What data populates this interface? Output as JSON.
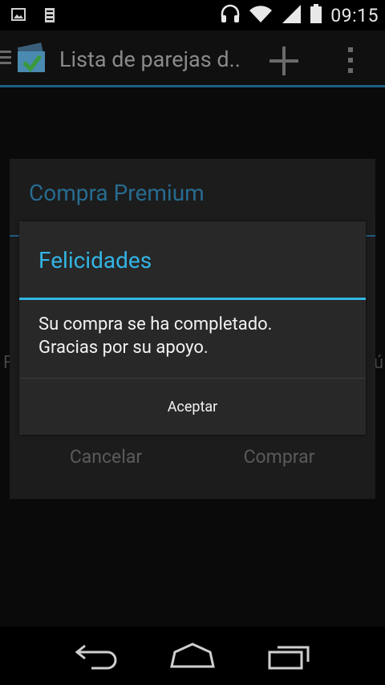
{
  "status_bar": {
    "time": "09:15",
    "icons": [
      "gallery-icon",
      "storage-icon",
      "headphones-icon",
      "wifi-icon",
      "signal-icon",
      "battery-icon"
    ]
  },
  "app_bar": {
    "title": "Lista de parejas d..",
    "icons": [
      "menu-icon",
      "app-logo-icon",
      "add-icon",
      "overflow-icon"
    ]
  },
  "background_dialog": {
    "title": "Compra Premium",
    "cancel_label": "Cancelar",
    "buy_label": "Comprar",
    "left_edge_text": "F",
    "right_edge_text": "ú"
  },
  "dialog": {
    "title": "Felicidades",
    "message": "Su compra se ha completado.\nGracias por su apoyo.",
    "accept_label": "Aceptar"
  },
  "nav_bar": {
    "icons": [
      "back-icon",
      "home-icon",
      "recent-apps-icon"
    ]
  },
  "colors": {
    "accent": "#33b5e5",
    "dialog_bg": "#282828",
    "dimmed_accent": "#276b8f"
  }
}
